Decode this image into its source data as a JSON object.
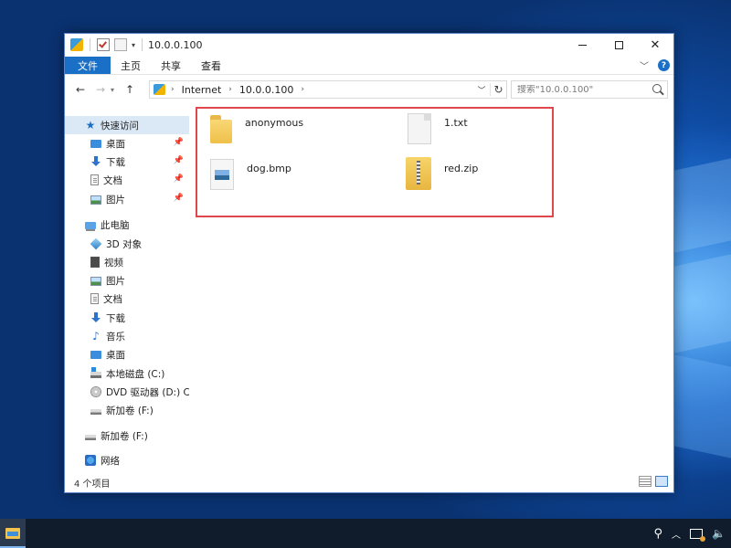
{
  "window": {
    "title": "10.0.0.100"
  },
  "ribbon": {
    "tabs": [
      "文件",
      "主页",
      "共享",
      "查看"
    ]
  },
  "address": {
    "crumbs": [
      "Internet",
      "10.0.0.100"
    ]
  },
  "search": {
    "placeholder": "搜索\"10.0.0.100\""
  },
  "sidebar": {
    "quick_access": "快速访问",
    "quick_items": [
      "桌面",
      "下载",
      "文档",
      "图片"
    ],
    "this_pc": "此电脑",
    "pc_items": [
      "3D 对象",
      "视频",
      "图片",
      "文档",
      "下载",
      "音乐",
      "桌面",
      "本地磁盘 (C:)",
      "DVD 驱动器 (D:) CE",
      "新加卷 (F:)"
    ],
    "volume_f": "新加卷 (F:)",
    "network": "网络"
  },
  "files": [
    {
      "name": "anonymous",
      "type": "folder-icon"
    },
    {
      "name": "1.txt",
      "type": "text-file-icon"
    },
    {
      "name": "dog.bmp",
      "type": "image-file-icon"
    },
    {
      "name": "red.zip",
      "type": "zip-file-icon"
    }
  ],
  "status": {
    "item_count": "4 个项目"
  },
  "colors": {
    "accent": "#1a6fc6",
    "highlight_border": "#e0474c"
  }
}
